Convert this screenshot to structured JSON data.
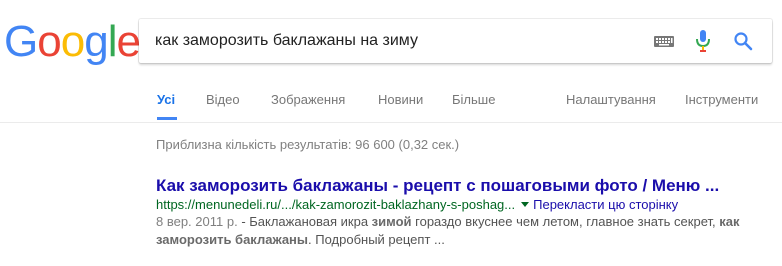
{
  "logo": {
    "letters": [
      "G",
      "o",
      "o",
      "g",
      "l",
      "e"
    ],
    "colors": [
      "#4285f4",
      "#ea4335",
      "#fbbc05",
      "#4285f4",
      "#34a853",
      "#ea4335"
    ]
  },
  "search": {
    "query": "как заморозить баклажаны на зиму"
  },
  "tabs": [
    {
      "label": "Усі"
    },
    {
      "label": "Відео"
    },
    {
      "label": "Зображення"
    },
    {
      "label": "Новини"
    },
    {
      "label": "Більше"
    },
    {
      "label": "Налаштування"
    },
    {
      "label": "Інструменти"
    }
  ],
  "stats": "Приблизна кількість результатів: 96 600 (0,32 сек.)",
  "result": {
    "title": "Как заморозить баклажаны - рецепт с пошаговыми фото / Меню ...",
    "url": "https://menunedeli.ru/.../kak-zamorozit-baklazhany-s-poshag...",
    "translate": "Перекласти цю сторінку",
    "date": "8 вер. 2011 р.",
    "snippet_1": " - Баклажановая икра ",
    "snippet_b1": "зимой",
    "snippet_2": " гораздо вкуснее чем летом, главное знать секрет, ",
    "snippet_b2": "как",
    "snippet_b3": "заморозить баклажаны",
    "snippet_3": ". Подробный рецепт ..."
  },
  "colors": {
    "link": "#1a0dab",
    "url": "#006621",
    "active_tab": "#1a73e8",
    "tab_underline": "#4285f4"
  }
}
